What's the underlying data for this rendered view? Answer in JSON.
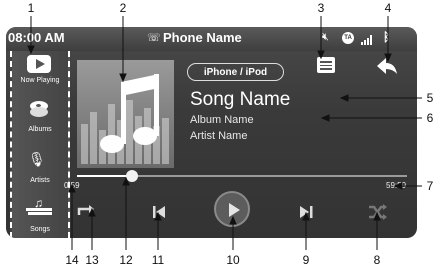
{
  "status_bar": {
    "time": "08:00 AM",
    "device_name": "Phone Name",
    "icons": [
      "bluetooth-phone-icon",
      "mute-icon",
      "ta-icon",
      "signal-icon",
      "bluetooth-icon"
    ]
  },
  "sidebar": {
    "items": [
      {
        "label": "Now Playing",
        "icon": "now-playing-icon"
      },
      {
        "label": "Albums",
        "icon": "albums-icon"
      },
      {
        "label": "Artists",
        "icon": "artists-icon"
      },
      {
        "label": "Songs",
        "icon": "songs-icon"
      }
    ]
  },
  "source_badge": "iPhone / iPod",
  "track": {
    "song": "Song Name",
    "album": "Album Name",
    "artist": "Artist Name"
  },
  "progress": {
    "elapsed": "0:59",
    "total": "59:59",
    "fraction": 0.17
  },
  "controls": [
    "repeat-icon",
    "previous-icon",
    "play-icon",
    "next-icon",
    "shuffle-icon"
  ],
  "callouts": [
    "1",
    "2",
    "3",
    "4",
    "5",
    "6",
    "7",
    "8",
    "9",
    "10",
    "11",
    "12",
    "13",
    "14"
  ]
}
